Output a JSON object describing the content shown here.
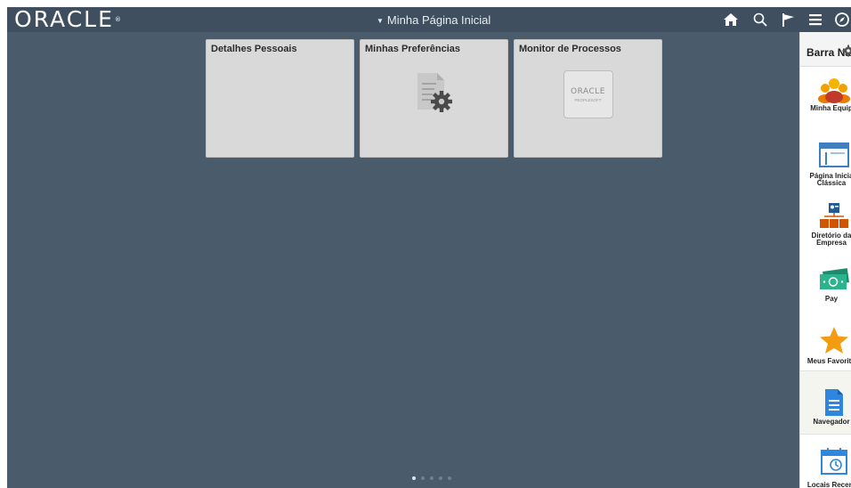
{
  "app": {
    "logo": "ORACLE",
    "page_title": "Minha Página Inicial"
  },
  "header_icons": [
    "home-icon",
    "search-icon",
    "flag-icon",
    "menu-icon",
    "compass-icon"
  ],
  "tiles": [
    {
      "title": "Detalhes Pessoais"
    },
    {
      "title": "Minhas Preferências",
      "icon": "gear-document-icon"
    },
    {
      "title": "Monitor de Processos",
      "icon": "oracle-peoplesoft-logo",
      "logo_text": "ORACLE",
      "logo_subtext": "PEOPLESOFT"
    }
  ],
  "pager": {
    "count": 5,
    "active": 1
  },
  "navbar": {
    "title": "Barra Nav",
    "items": [
      {
        "label": "Minha Equip",
        "icon": "team-icon"
      },
      {
        "label1": "Página Inicia",
        "label2": "Clássica",
        "icon": "window-icon"
      },
      {
        "label1": "Diretório da",
        "label2": "Empresa",
        "icon": "org-chart-icon"
      },
      {
        "label": "Pay",
        "icon": "money-icon"
      },
      {
        "label": "Meus Favorito",
        "icon": "star-icon"
      },
      {
        "label": "Navegador",
        "icon": "document-icon"
      },
      {
        "label": "Locais Recent",
        "icon": "calendar-icon"
      }
    ]
  },
  "colors": {
    "topbar": "#3f4f5f",
    "content": "#4a5b6c",
    "tile": "#d9d9d9"
  }
}
